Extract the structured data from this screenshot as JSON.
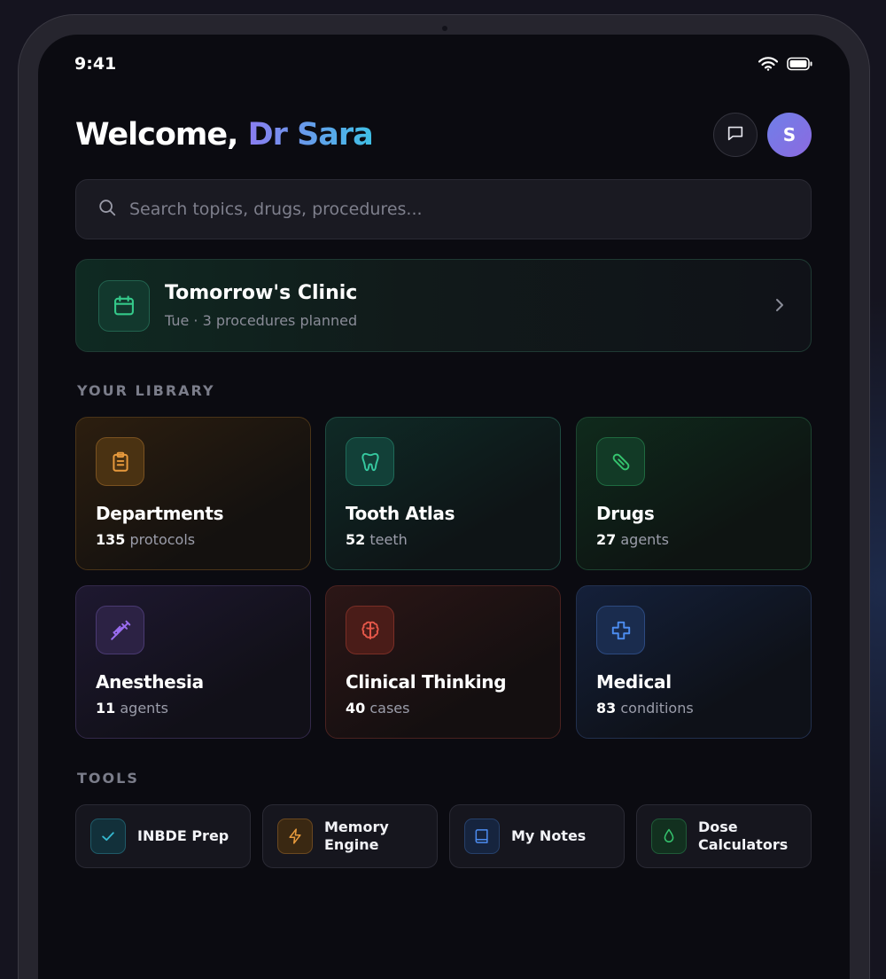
{
  "status": {
    "time": "9:41"
  },
  "header": {
    "welcome_prefix": "Welcome,",
    "user_name": "Dr Sara",
    "avatar_initial": "S"
  },
  "search": {
    "placeholder": "Search topics, drugs, procedures..."
  },
  "clinic": {
    "title": "Tomorrow's Clinic",
    "subtitle": "Tue · 3 procedures planned"
  },
  "library": {
    "label": "YOUR LIBRARY",
    "cards": [
      {
        "title": "Departments",
        "count": "135",
        "unit": "protocols",
        "icon": "clipboard-icon",
        "accent": "#e89a3c"
      },
      {
        "title": "Tooth Atlas",
        "count": "52",
        "unit": "teeth",
        "icon": "tooth-icon",
        "accent": "#36c9a0"
      },
      {
        "title": "Drugs",
        "count": "27",
        "unit": "agents",
        "icon": "pill-icon",
        "accent": "#35c46e"
      },
      {
        "title": "Anesthesia",
        "count": "11",
        "unit": "agents",
        "icon": "syringe-icon",
        "accent": "#9a6df0"
      },
      {
        "title": "Clinical Thinking",
        "count": "40",
        "unit": "cases",
        "icon": "brain-icon",
        "accent": "#e8584a"
      },
      {
        "title": "Medical",
        "count": "83",
        "unit": "conditions",
        "icon": "medical-cross-icon",
        "accent": "#4c8cf0"
      }
    ]
  },
  "tools": {
    "label": "TOOLS",
    "items": [
      {
        "label": "INBDE Prep",
        "icon": "check-icon",
        "accent": "#35b8d0"
      },
      {
        "label": "Memory\nEngine",
        "icon": "lightning-icon",
        "accent": "#e89a3c"
      },
      {
        "label": "My Notes",
        "icon": "book-icon",
        "accent": "#4c8cf0"
      },
      {
        "label": "Dose\nCalculators",
        "icon": "droplet-icon",
        "accent": "#35c46e"
      }
    ]
  }
}
